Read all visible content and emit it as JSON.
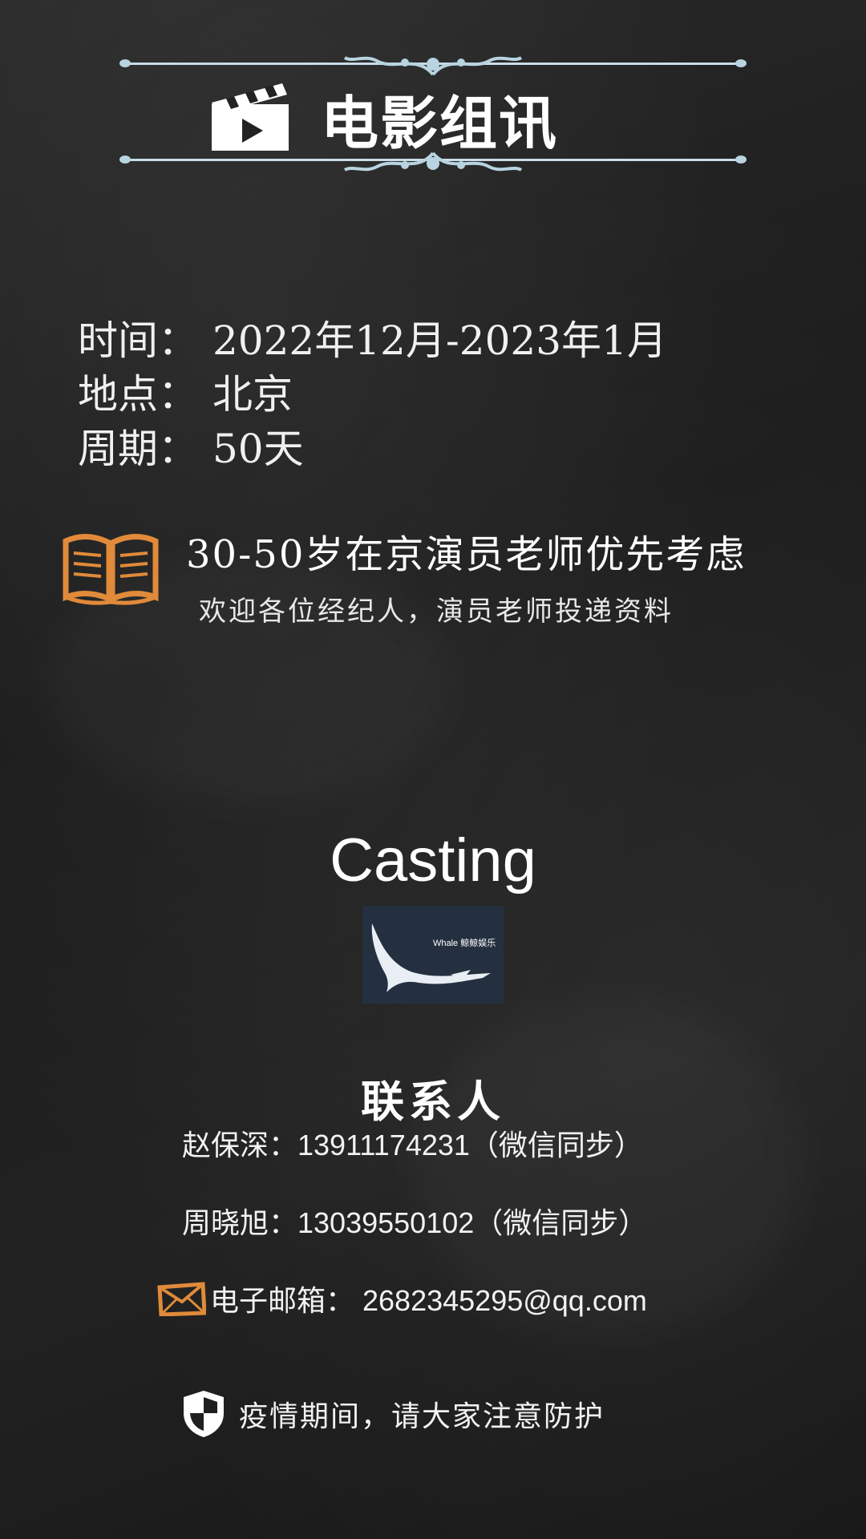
{
  "header": {
    "title": "电影组讯"
  },
  "info": [
    {
      "label": "时间：",
      "value": "2022年12月-2023年1月"
    },
    {
      "label": "地点：",
      "value": "北京"
    },
    {
      "label": "周期：",
      "value": "50天"
    }
  ],
  "highlight": {
    "main": "30-50岁在京演员老师优先考虑",
    "sub": "欢迎各位经纪人，演员老师投递资料"
  },
  "casting": {
    "title": "Casting",
    "logo_text": "Whale 鲸鲸娱乐"
  },
  "contacts": {
    "heading": "联系人",
    "people": [
      {
        "name": "赵保深：",
        "phone": "13911174231",
        "note": "（微信同步）"
      },
      {
        "name": "周晓旭：",
        "phone": "13039550102",
        "note": "（微信同步）"
      }
    ],
    "email_label": "电子邮箱：",
    "email": "2682345295@qq.com"
  },
  "notice": "疫情期间，请大家注意防护",
  "colors": {
    "background": "#1f1f1f",
    "accent_orange": "#e08a3a",
    "ornament": "#c9dde6",
    "logo_bg": "#243040"
  }
}
